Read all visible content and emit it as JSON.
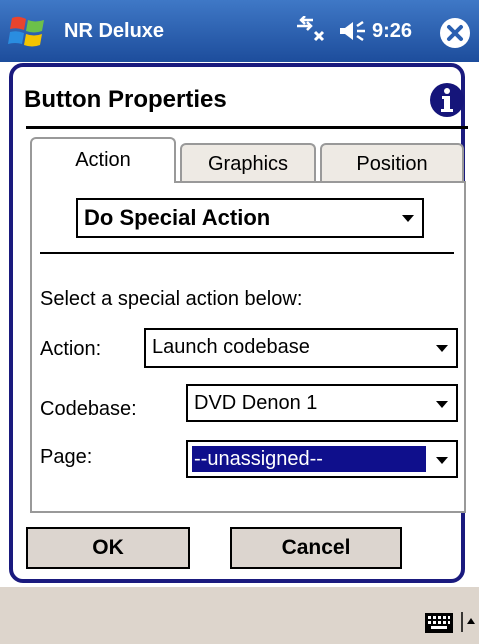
{
  "statusbar": {
    "app_title": "NR Deluxe",
    "time": "9:26",
    "icons": [
      "windows-start-icon",
      "network-icon",
      "volume-icon",
      "close-icon"
    ]
  },
  "dialog": {
    "title": "Button Properties",
    "info_icon": "info-icon",
    "tabs": [
      {
        "label": "Action",
        "active": true
      },
      {
        "label": "Graphics",
        "active": false
      },
      {
        "label": "Position",
        "active": false
      }
    ],
    "mode_select": {
      "value": "Do Special Action"
    },
    "prompt": "Select a special action below:",
    "fields": {
      "action": {
        "label": "Action:",
        "value": "Launch codebase"
      },
      "codebase": {
        "label": "Codebase:",
        "value": "DVD Denon 1"
      },
      "page": {
        "label": "Page:",
        "value": "--unassigned--",
        "selected": true
      }
    },
    "buttons": {
      "ok": "OK",
      "cancel": "Cancel"
    }
  },
  "menubar": {
    "icons": [
      "keyboard-icon",
      "sip-arrow-up-icon"
    ]
  },
  "colors": {
    "title_bar": "#2a5fb0",
    "frame_border": "#1a1a7e",
    "selection": "#0f0f8c",
    "button_face": "#dcd5cf",
    "menubar": "#ddd5cc"
  }
}
